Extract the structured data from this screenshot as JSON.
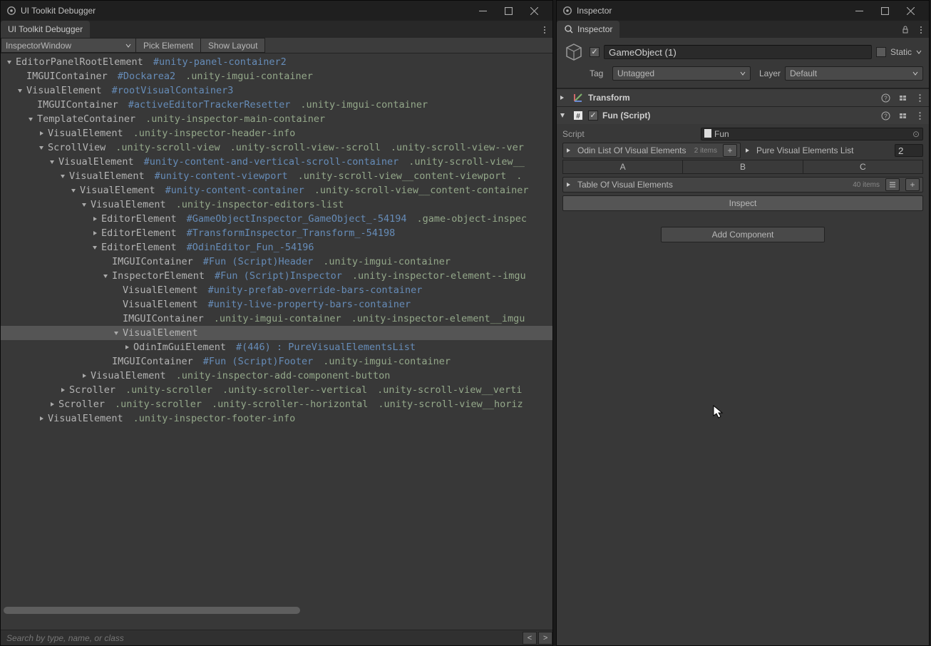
{
  "left": {
    "window_title": "UI Toolkit Debugger",
    "tab": "UI Toolkit Debugger",
    "toolbar": {
      "target_dropdown": "InspectorWindow",
      "pick_element": "Pick Element",
      "show_layout": "Show Layout"
    },
    "search_placeholder": "Search by type, name, or class",
    "nav_prev": "<",
    "nav_next": ">",
    "tree": [
      {
        "depth": 0,
        "expand": "down",
        "tokens": [
          {
            "t": "name",
            "v": "EditorPanelRootElement"
          },
          {
            "t": "id",
            "v": "#unity-panel-container2"
          }
        ]
      },
      {
        "depth": 1,
        "expand": "none",
        "tokens": [
          {
            "t": "name",
            "v": "IMGUIContainer"
          },
          {
            "t": "id",
            "v": "#Dockarea2"
          },
          {
            "t": "class",
            "v": ".unity-imgui-container"
          }
        ]
      },
      {
        "depth": 1,
        "expand": "down",
        "tokens": [
          {
            "t": "name",
            "v": "VisualElement"
          },
          {
            "t": "id",
            "v": "#rootVisualContainer3"
          }
        ]
      },
      {
        "depth": 2,
        "expand": "none",
        "tokens": [
          {
            "t": "name",
            "v": "IMGUIContainer"
          },
          {
            "t": "id",
            "v": "#activeEditorTrackerResetter"
          },
          {
            "t": "class",
            "v": ".unity-imgui-container"
          }
        ]
      },
      {
        "depth": 2,
        "expand": "down",
        "tokens": [
          {
            "t": "name",
            "v": "TemplateContainer"
          },
          {
            "t": "class",
            "v": ".unity-inspector-main-container"
          }
        ]
      },
      {
        "depth": 3,
        "expand": "right",
        "tokens": [
          {
            "t": "name",
            "v": "VisualElement"
          },
          {
            "t": "class",
            "v": ".unity-inspector-header-info"
          }
        ]
      },
      {
        "depth": 3,
        "expand": "down",
        "tokens": [
          {
            "t": "name",
            "v": "ScrollView"
          },
          {
            "t": "class",
            "v": ".unity-scroll-view"
          },
          {
            "t": "class",
            "v": ".unity-scroll-view--scroll"
          },
          {
            "t": "class",
            "v": ".unity-scroll-view--ver"
          }
        ]
      },
      {
        "depth": 4,
        "expand": "down",
        "tokens": [
          {
            "t": "name",
            "v": "VisualElement"
          },
          {
            "t": "id",
            "v": "#unity-content-and-vertical-scroll-container"
          },
          {
            "t": "class",
            "v": ".unity-scroll-view__"
          }
        ]
      },
      {
        "depth": 5,
        "expand": "down",
        "tokens": [
          {
            "t": "name",
            "v": "VisualElement"
          },
          {
            "t": "id",
            "v": "#unity-content-viewport"
          },
          {
            "t": "class",
            "v": ".unity-scroll-view__content-viewport"
          },
          {
            "t": "class",
            "v": "."
          }
        ]
      },
      {
        "depth": 6,
        "expand": "down",
        "tokens": [
          {
            "t": "name",
            "v": "VisualElement"
          },
          {
            "t": "id",
            "v": "#unity-content-container"
          },
          {
            "t": "class",
            "v": ".unity-scroll-view__content-container"
          }
        ]
      },
      {
        "depth": 7,
        "expand": "down",
        "tokens": [
          {
            "t": "name",
            "v": "VisualElement"
          },
          {
            "t": "class",
            "v": ".unity-inspector-editors-list"
          }
        ]
      },
      {
        "depth": 8,
        "expand": "right",
        "tokens": [
          {
            "t": "name",
            "v": "EditorElement"
          },
          {
            "t": "id",
            "v": "#GameObjectInspector_GameObject_-54194"
          },
          {
            "t": "class",
            "v": ".game-object-inspec"
          }
        ]
      },
      {
        "depth": 8,
        "expand": "right",
        "tokens": [
          {
            "t": "name",
            "v": "EditorElement"
          },
          {
            "t": "id",
            "v": "#TransformInspector_Transform_-54198"
          }
        ]
      },
      {
        "depth": 8,
        "expand": "down",
        "tokens": [
          {
            "t": "name",
            "v": "EditorElement"
          },
          {
            "t": "id",
            "v": "#OdinEditor_Fun_-54196"
          }
        ]
      },
      {
        "depth": 9,
        "expand": "none",
        "tokens": [
          {
            "t": "name",
            "v": "IMGUIContainer"
          },
          {
            "t": "id",
            "v": "#Fun (Script)Header"
          },
          {
            "t": "class",
            "v": ".unity-imgui-container"
          }
        ]
      },
      {
        "depth": 9,
        "expand": "down",
        "tokens": [
          {
            "t": "name",
            "v": "InspectorElement"
          },
          {
            "t": "id",
            "v": "#Fun (Script)Inspector"
          },
          {
            "t": "class",
            "v": ".unity-inspector-element--imgu"
          }
        ]
      },
      {
        "depth": 10,
        "expand": "none",
        "tokens": [
          {
            "t": "name",
            "v": "VisualElement"
          },
          {
            "t": "id",
            "v": "#unity-prefab-override-bars-container"
          }
        ]
      },
      {
        "depth": 10,
        "expand": "none",
        "tokens": [
          {
            "t": "name",
            "v": "VisualElement"
          },
          {
            "t": "id",
            "v": "#unity-live-property-bars-container"
          }
        ]
      },
      {
        "depth": 10,
        "expand": "none",
        "tokens": [
          {
            "t": "name",
            "v": "IMGUIContainer"
          },
          {
            "t": "class",
            "v": ".unity-imgui-container"
          },
          {
            "t": "class",
            "v": ".unity-inspector-element__imgu"
          }
        ]
      },
      {
        "depth": 10,
        "expand": "down",
        "selected": true,
        "tokens": [
          {
            "t": "name",
            "v": "VisualElement"
          }
        ]
      },
      {
        "depth": 11,
        "expand": "right",
        "tokens": [
          {
            "t": "name",
            "v": "OdinImGuiElement"
          },
          {
            "t": "id",
            "v": "#(446) : PureVisualElementsList"
          }
        ]
      },
      {
        "depth": 9,
        "expand": "none",
        "tokens": [
          {
            "t": "name",
            "v": "IMGUIContainer"
          },
          {
            "t": "id",
            "v": "#Fun (Script)Footer"
          },
          {
            "t": "class",
            "v": ".unity-imgui-container"
          }
        ]
      },
      {
        "depth": 7,
        "expand": "right",
        "tokens": [
          {
            "t": "name",
            "v": "VisualElement"
          },
          {
            "t": "class",
            "v": ".unity-inspector-add-component-button"
          }
        ]
      },
      {
        "depth": 5,
        "expand": "right",
        "tokens": [
          {
            "t": "name",
            "v": "Scroller"
          },
          {
            "t": "class",
            "v": ".unity-scroller"
          },
          {
            "t": "class",
            "v": ".unity-scroller--vertical"
          },
          {
            "t": "class",
            "v": ".unity-scroll-view__verti"
          }
        ]
      },
      {
        "depth": 4,
        "expand": "right",
        "tokens": [
          {
            "t": "name",
            "v": "Scroller"
          },
          {
            "t": "class",
            "v": ".unity-scroller"
          },
          {
            "t": "class",
            "v": ".unity-scroller--horizontal"
          },
          {
            "t": "class",
            "v": ".unity-scroll-view__horiz"
          }
        ]
      },
      {
        "depth": 3,
        "expand": "right",
        "tokens": [
          {
            "t": "name",
            "v": "VisualElement"
          },
          {
            "t": "class",
            "v": ".unity-inspector-footer-info"
          }
        ]
      }
    ]
  },
  "right": {
    "window_title": "Inspector",
    "tab": "Inspector",
    "gameobject": {
      "enabled": true,
      "name": "GameObject (1)",
      "static_label": "Static",
      "static_checked": false,
      "tag_label": "Tag",
      "tag_value": "Untagged",
      "layer_label": "Layer",
      "layer_value": "Default"
    },
    "components": {
      "transform": {
        "title": "Transform"
      },
      "fun": {
        "title": "Fun (Script)",
        "enabled": true,
        "script_label": "Script",
        "script_value": "Fun",
        "odin_list_label": "Odin List Of Visual Elements",
        "odin_list_count": "2 items",
        "pure_list_label": "Pure Visual Elements List",
        "pure_list_count": "2",
        "abc": [
          "A",
          "B",
          "C"
        ],
        "table_label": "Table Of Visual Elements",
        "table_count": "40 items",
        "inspect_button": "Inspect"
      }
    },
    "add_component": "Add Component"
  }
}
